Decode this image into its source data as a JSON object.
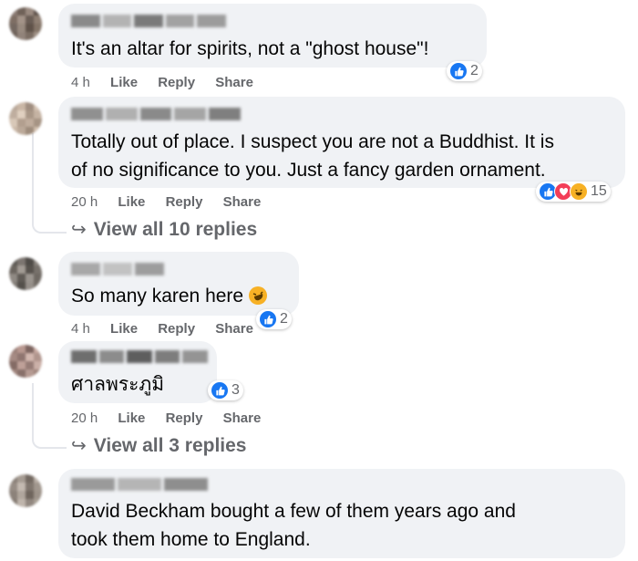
{
  "comments": [
    {
      "text": "It's an altar for spirits, not a \"ghost house\"!",
      "time": "4 h",
      "like_label": "Like",
      "reply_label": "Reply",
      "share_label": "Share",
      "reactions": [
        "like"
      ],
      "reaction_count": "2",
      "avatar_colors": [
        "#8b7b74",
        "#6f6158",
        "#9a8a80",
        "#5d514a",
        "#7e6e64",
        "#a39388",
        "#6a5d55",
        "#8f7f73",
        "#746860",
        "#988a7f",
        "#5f5249",
        "#847568",
        "#6d6058",
        "#91837a",
        "#7b6d63",
        "#a09287"
      ],
      "name_colors": [
        "#8a8a8a",
        "#b3b3b3",
        "#7a7a7a",
        "#a2a2a2",
        "#9c9c9c"
      ]
    },
    {
      "text_lines": [
        "Totally out of place. I suspect you are not a Buddhist. It is",
        "of no significance to you. Just a fancy garden ornament."
      ],
      "time": "20 h",
      "like_label": "Like",
      "reply_label": "Reply",
      "share_label": "Share",
      "reactions": [
        "like",
        "love",
        "haha"
      ],
      "reaction_count": "15",
      "view_replies": "View all 10 replies",
      "avatar_colors": [
        "#b9a89a",
        "#c9b6a5",
        "#a08e80",
        "#d3c2b2",
        "#bfae9f",
        "#e0d0c0",
        "#a99787",
        "#c5b3a3",
        "#d8c8b8",
        "#b29f8f",
        "#c0ad9d",
        "#a69484",
        "#ccbaa9",
        "#bba999",
        "#9e8c7c",
        "#d1bfae"
      ],
      "name_colors": [
        "#909090",
        "#b0b0b0",
        "#8a8a8a",
        "#a5a5a5",
        "#7f7f7f"
      ]
    },
    {
      "text": "So many karen here",
      "time": "4 h",
      "like_label": "Like",
      "reply_label": "Reply",
      "share_label": "Share",
      "reactions": [
        "like"
      ],
      "reaction_count": "2",
      "avatar_colors": [
        "#5e5a55",
        "#7c7570",
        "#4f4b47",
        "#8a847e",
        "#6b655f",
        "#a29b94",
        "#57524d",
        "#77716b",
        "#8f8983",
        "#605b56",
        "#9b958f",
        "#6f6963",
        "#837d77",
        "#54504b",
        "#958f89",
        "#726c66"
      ],
      "name_colors": [
        "#a8a8a8",
        "#c2c2c2",
        "#9d9d9d"
      ]
    },
    {
      "text": "ศาลพระภูมิ",
      "time": "20 h",
      "like_label": "Like",
      "reply_label": "Reply",
      "share_label": "Share",
      "reactions": [
        "like"
      ],
      "reaction_count": "3",
      "view_replies": "View all 3 replies",
      "avatar_colors": [
        "#9a7f78",
        "#b89890",
        "#7d6560",
        "#c7a9a1",
        "#a58a83",
        "#8f7570",
        "#d2b7af",
        "#b0958d",
        "#846b65",
        "#bea098",
        "#967c76",
        "#cbb0a8",
        "#a2877f",
        "#88706a",
        "#b59a92",
        "#9f847c"
      ],
      "name_colors": [
        "#6e6e6e",
        "#8c8c8c",
        "#5e5e5e",
        "#7d7d7d",
        "#949494"
      ]
    },
    {
      "text_lines": [
        "David Beckham bought a few of them years ago and",
        "took them home to England."
      ],
      "avatar_colors": [
        "#8a8078",
        "#a69c93",
        "#746a62",
        "#b8aea5",
        "#978d85",
        "#c4bab1",
        "#81776f",
        "#a1978e",
        "#8c827a",
        "#b0a69d",
        "#6f655d",
        "#9d938a",
        "#857b73",
        "#bfb5ac",
        "#928880",
        "#a9a096"
      ],
      "name_colors": [
        "#9a9a9a",
        "#b5b5b5",
        "#8e8e8e"
      ]
    }
  ]
}
